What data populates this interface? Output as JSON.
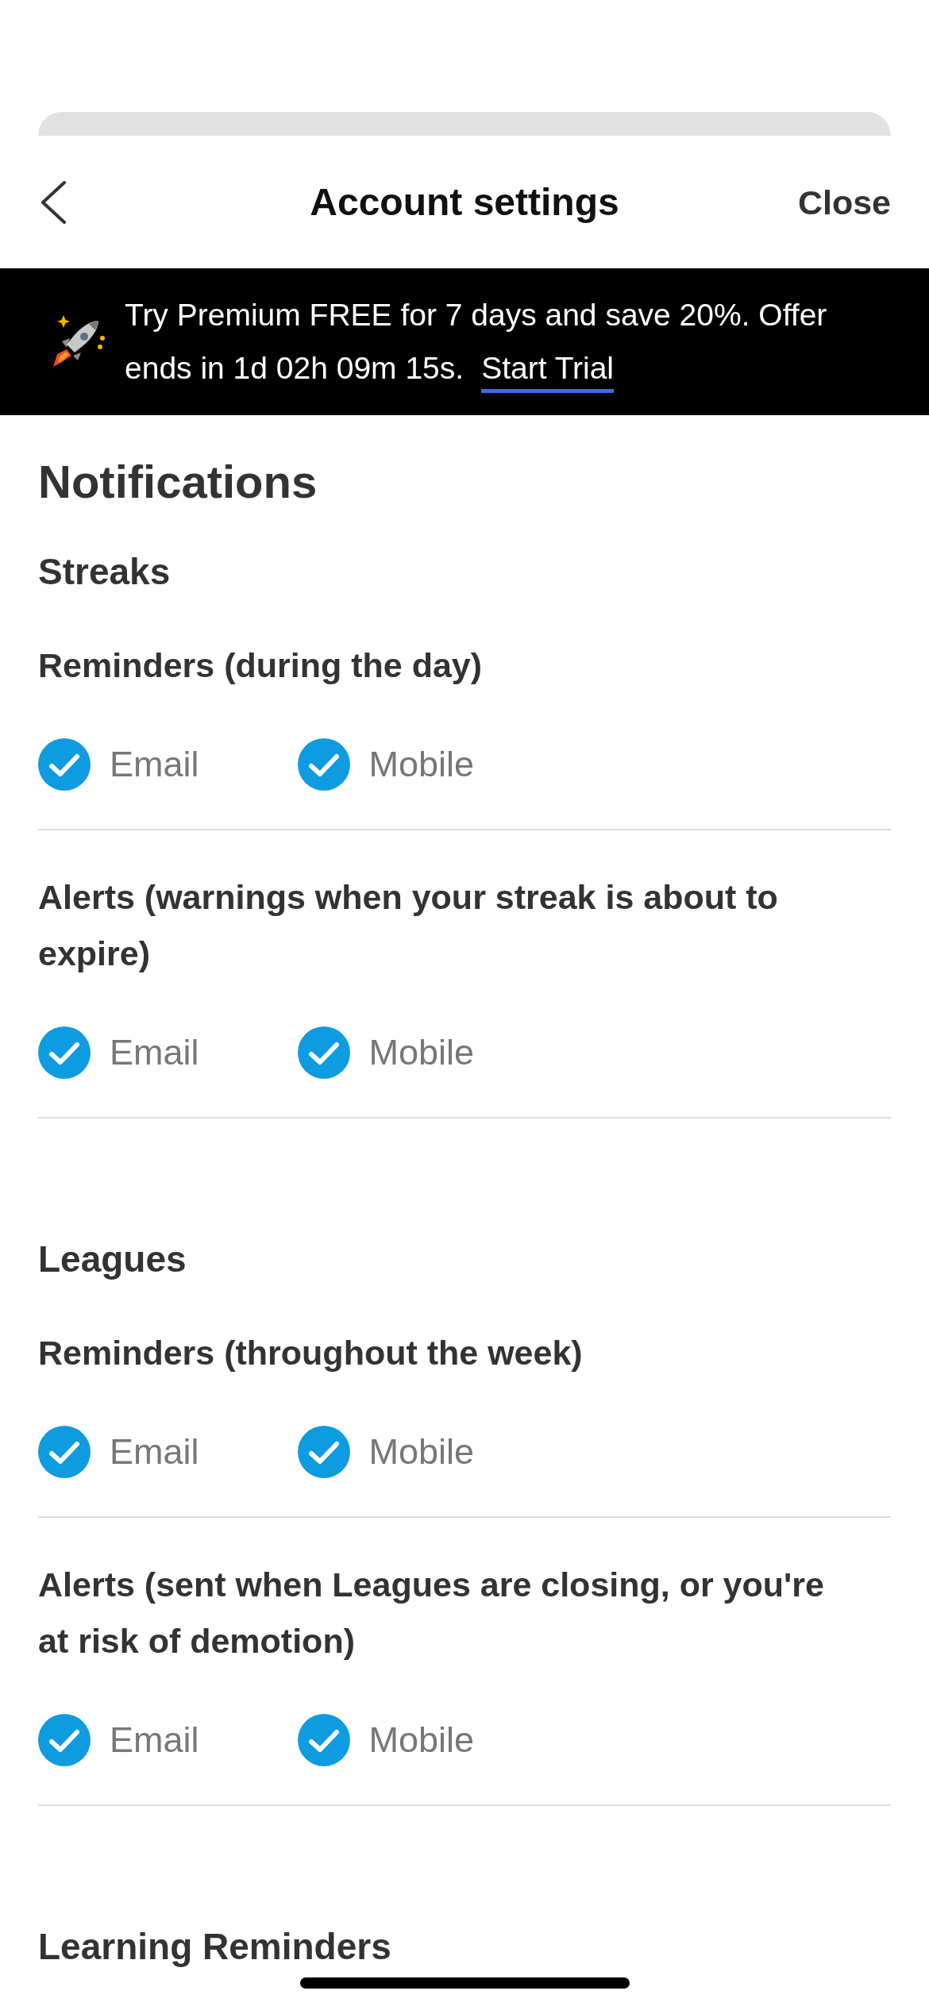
{
  "header": {
    "title": "Account settings",
    "close": "Close"
  },
  "promo": {
    "text": "Try Premium FREE for 7 days and save 20%. Offer ends in 1d 02h 09m 15s.",
    "link": "Start Trial"
  },
  "page_title": "Notifications",
  "sections": [
    {
      "title": "Streaks",
      "groups": [
        {
          "label": "Reminders (during the day)",
          "options": [
            {
              "label": "Email",
              "checked": true
            },
            {
              "label": "Mobile",
              "checked": true
            }
          ]
        },
        {
          "label": "Alerts (warnings when your streak is about to expire)",
          "options": [
            {
              "label": "Email",
              "checked": true
            },
            {
              "label": "Mobile",
              "checked": true
            }
          ]
        }
      ]
    },
    {
      "title": "Leagues",
      "groups": [
        {
          "label": "Reminders (throughout the week)",
          "options": [
            {
              "label": "Email",
              "checked": true
            },
            {
              "label": "Mobile",
              "checked": true
            }
          ]
        },
        {
          "label": "Alerts (sent when Leagues are closing, or you're at risk of demotion)",
          "options": [
            {
              "label": "Email",
              "checked": true
            },
            {
              "label": "Mobile",
              "checked": true
            }
          ]
        }
      ]
    },
    {
      "title": "Learning Reminders"
    }
  ]
}
